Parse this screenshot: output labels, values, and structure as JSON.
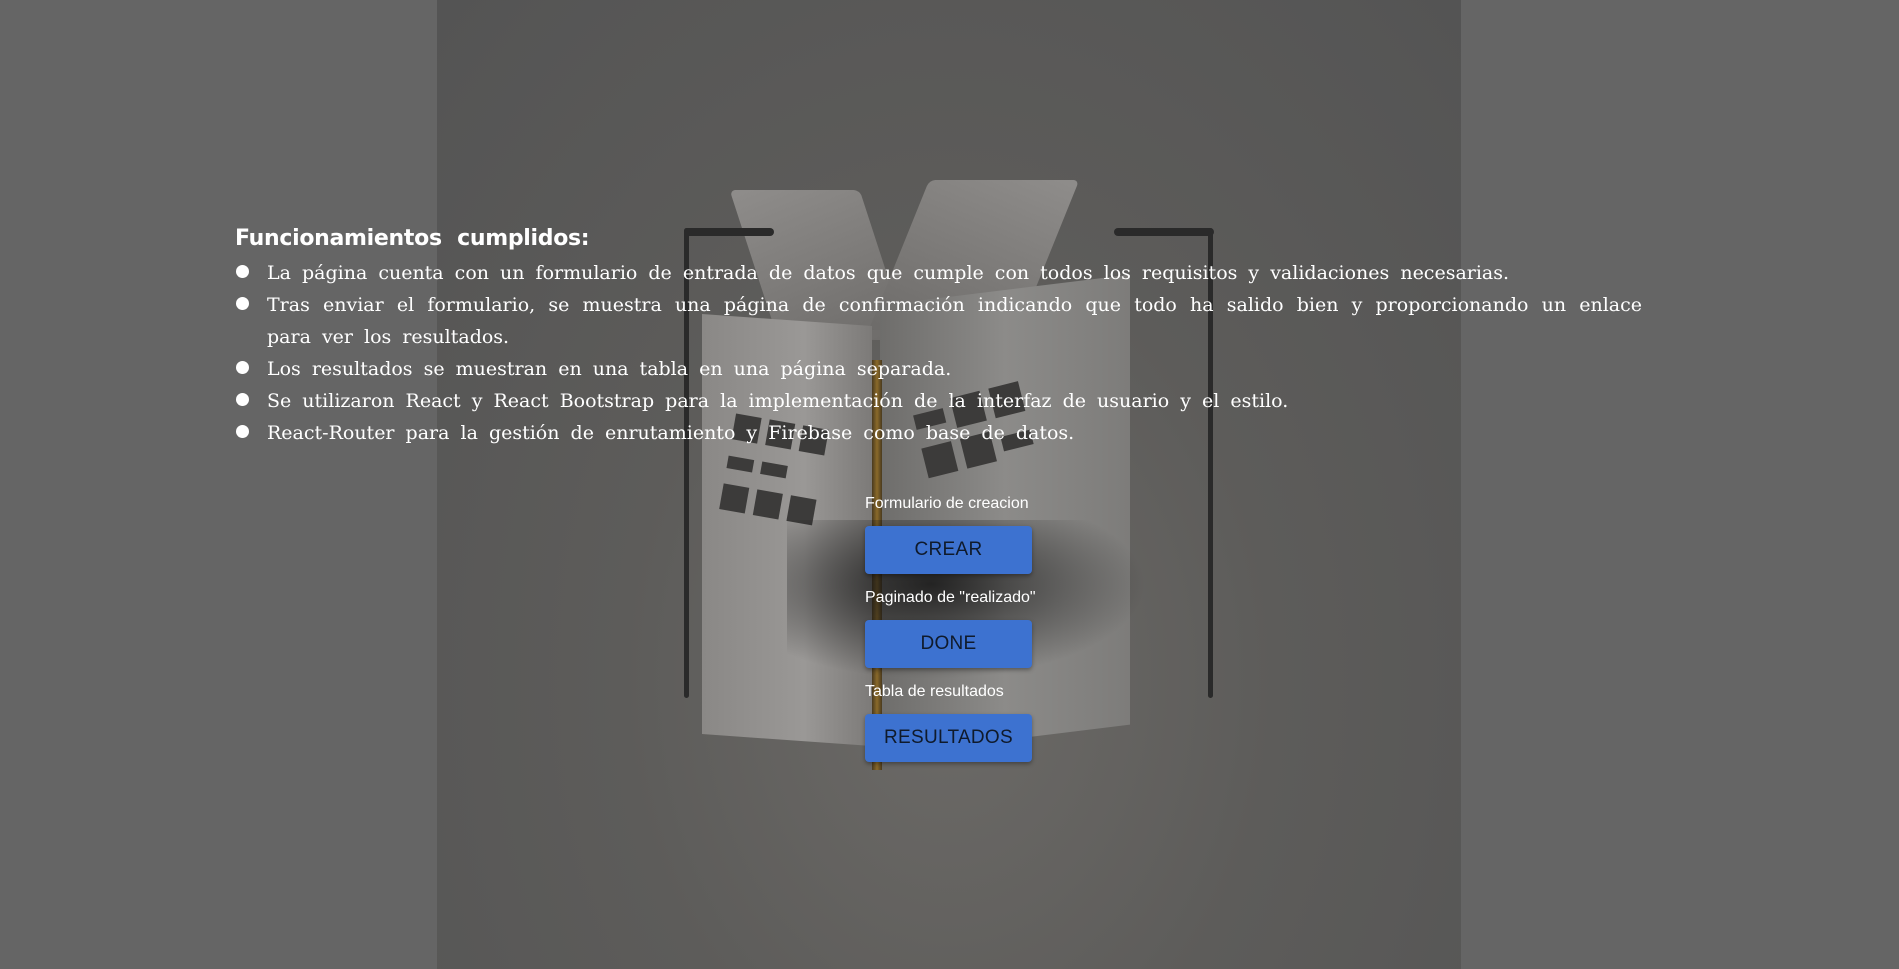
{
  "features": {
    "title": "Funcionamientos cumplidos:",
    "items": [
      "La página cuenta con un formulario de entrada de datos que cumple con todos los requisitos y validaciones necesarias.",
      "Tras enviar el formulario, se muestra una página de confirmación indicando que todo ha salido bien y proporcionando un enlace para ver los resultados.",
      "Los resultados se muestran en una tabla en una página separada.",
      "Se utilizaron React y React Bootstrap para la implementación de la interfaz de usuario y el estilo.",
      "React-Router para la gestión de enrutamiento y Firebase como base de datos."
    ]
  },
  "actions": [
    {
      "label": "Formulario de creacion",
      "button": "CREAR"
    },
    {
      "label": "Paginado de \"realizado\"",
      "button": "DONE"
    },
    {
      "label": "Tabla de resultados",
      "button": "RESULTADOS"
    }
  ],
  "colors": {
    "page_background": "#656565",
    "button_background": "#3d72d0",
    "button_text": "#0f1a2b",
    "text": "#ffffff"
  }
}
